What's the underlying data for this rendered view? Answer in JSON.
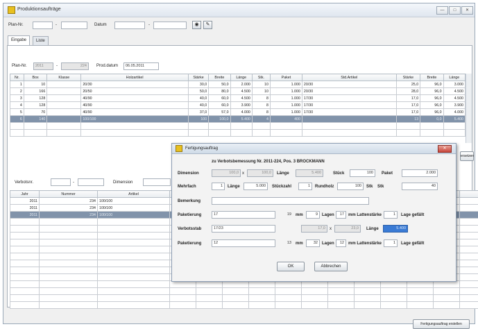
{
  "window": {
    "title": "Produktionsaufträge",
    "controls": [
      "—",
      "□",
      "✕"
    ]
  },
  "filter": {
    "plan_label": "Plan-Nr.",
    "datum_label": "Datum",
    "sep": "-",
    "binoculars_icon": "binoculars-icon",
    "edit_icon": "edit-icon"
  },
  "tabs": [
    "Eingabe",
    "Liste"
  ],
  "plan_row": {
    "label": "Plan-Nr.",
    "year": "2011",
    "sep": "-",
    "number": "224",
    "prod_label": "Prod.datum",
    "prod_date": "06.05.2011"
  },
  "top_table": {
    "headers": [
      "Nr.",
      "Box",
      "Klasse",
      "Holzartikel",
      "Stärke",
      "Breite",
      "Länge",
      "Stk.",
      "Paket",
      "Std.Artikel",
      "Stärke",
      "Breite",
      "Länge"
    ],
    "rows": [
      [
        "1",
        "10",
        "",
        "20/30",
        "30,0",
        "50,0",
        "2.000",
        "10",
        "1.000",
        "20/30",
        "25,0",
        "96,0",
        "3.000"
      ],
      [
        "2",
        "166",
        "",
        "20/50",
        "50,0",
        "80,0",
        "4.500",
        "10",
        "1.000",
        "20/30",
        "28,0",
        "96,0",
        "4.500"
      ],
      [
        "3",
        "128",
        "",
        "40/90",
        "40,0",
        "60,0",
        "4.500",
        "8",
        "1.000",
        "17/30",
        "17,0",
        "96,0",
        "4.500"
      ],
      [
        "4",
        "128",
        "",
        "40/90",
        "40,0",
        "60,0",
        "3.900",
        "8",
        "1.000",
        "17/30",
        "17,0",
        "96,0",
        "3.900"
      ],
      [
        "5",
        "70",
        "",
        "40/90",
        "37,0",
        "57,0",
        "4.000",
        "8",
        "1.000",
        "17/30",
        "17,0",
        "96,0",
        "4.000"
      ],
      [
        "6",
        "140",
        "",
        "100/100",
        "100",
        "100,0",
        "5.400",
        "4",
        "400",
        "",
        "13",
        "0,0",
        "5.400"
      ]
    ],
    "selected_row": 5
  },
  "bottom_filter": {
    "verbotsnr_label": "Verbotsnr.",
    "dimension_label": "Dimension"
  },
  "bottom_table": {
    "headers": [
      "Jahr",
      "Nummer",
      "Artikel"
    ],
    "rows": [
      [
        "2011",
        "234",
        "100/100"
      ],
      [
        "2011",
        "234",
        "100/100"
      ],
      [
        "2011",
        "234",
        "100/100"
      ]
    ],
    "selected_row": 2
  },
  "right_edge_button": "ersetzen",
  "footer_button": "Fertigungsauftrag erstellen",
  "dialog": {
    "title": "Fertigungsauftrag",
    "subtitle": "zu Verbotsbemessung Nr. 2011-224, Pos. 3 BROCKMANN",
    "dimension_label": "Dimension",
    "dim1": "100,0",
    "times": "x",
    "dim2": "100,0",
    "laenge_label": "Länge",
    "laenge_value": "5.400",
    "stueck_label": "Stück",
    "stueck_value": "100",
    "paket_label": "Paket",
    "paket_value": "2.000",
    "mehrfach_label": "Mehrfach",
    "mehrfach_value": "1",
    "laenge2_label": "Länge",
    "laenge2_value": "5.000",
    "stueckzahl_label": "Stückzahl",
    "stueckzahl_value": "1",
    "rundholz_label": "Rundholz",
    "rundholz_value": "100",
    "stk_label": "Stk",
    "stk_label2": "Stk",
    "stk_value": "40",
    "bemerkung_label": "Bemerkung",
    "paket1_label": "Paketierung",
    "paket1_value": "17",
    "paket1_num": "19",
    "mm_label": "mm",
    "lagen1": "9",
    "lagen_label": "Lagen",
    "lagen1b": "17",
    "lattenstaerke_label": "mm Lattenstärke",
    "lage_val1": "1",
    "lage_gefaelt_label": "Lage gefällt",
    "verbotsstab_label": "Verbotsstab",
    "verbotsstab_value": "17/23",
    "vs_dim1": "17,0",
    "vs_dim2": "23,0",
    "vs_laenge_label": "Länge",
    "vs_laenge_value": "5.400",
    "paket2_label": "Paketierung",
    "paket2_value": "12",
    "paket2_num": "13",
    "lagen2": "32",
    "lagen2b": "12",
    "lage_val2": "1",
    "ok_label": "OK",
    "cancel_label": "Abbrechen",
    "close_icon": "✕"
  },
  "colors": {
    "selection": "#8193aa",
    "dialog_close": "#c8453a",
    "highlight_field": "#3a7bd5"
  }
}
